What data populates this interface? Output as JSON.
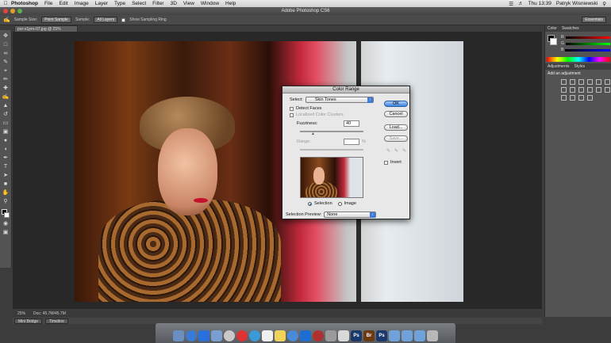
{
  "menubar": {
    "app_name": "Photoshop",
    "items": [
      "File",
      "Edit",
      "Image",
      "Layer",
      "Type",
      "Select",
      "Filter",
      "3D",
      "View",
      "Window",
      "Help"
    ],
    "clock": "Thu 13:39",
    "user": "Patryk Wisniewski"
  },
  "window": {
    "title": "Adobe Photoshop CS6"
  },
  "options_bar": {
    "sample_size_label": "Sample Size:",
    "sample_size_value": "Point Sample",
    "sample_label": "Sample:",
    "sample_value": "All Layers",
    "show_sampling_ring": "Show Sampling Ring",
    "workspace": "Essentials"
  },
  "document": {
    "tab_title": "por-x1pro-07.jpg @ 25% (RGB/8*)",
    "zoom": "25%",
    "doc_info": "Doc: 45.7M/45.7M"
  },
  "bottom_tabs": [
    "Mini Bridge",
    "Timeline"
  ],
  "panels": {
    "color_tabs": [
      "Color",
      "Swatches"
    ],
    "rgb_labels": [
      "R",
      "G",
      "B"
    ],
    "adjustments_tabs": [
      "Adjustments",
      "Styles"
    ],
    "adjustments_title": "Add an adjustment"
  },
  "dialog": {
    "title": "Color Range",
    "select_label": "Select:",
    "select_value": "Skin Tones",
    "detect_faces": "Detect Faces",
    "localized_color_clusters": "Localized Color Clusters",
    "fuzziness_label": "Fuzziness:",
    "fuzziness_value": "40",
    "range_label": "Range:",
    "range_value": "",
    "range_unit": "%",
    "ok": "OK",
    "cancel": "Cancel",
    "load": "Load...",
    "save": "Save...",
    "invert": "Invert",
    "radio_selection": "Selection",
    "radio_image": "Image",
    "preview_label": "Selection Preview:",
    "preview_value": "None"
  },
  "dock": {
    "ps_label": "Ps",
    "br_label": "Br"
  },
  "colors": {
    "accent": "#3f84e0",
    "panel_bg": "#535353"
  }
}
